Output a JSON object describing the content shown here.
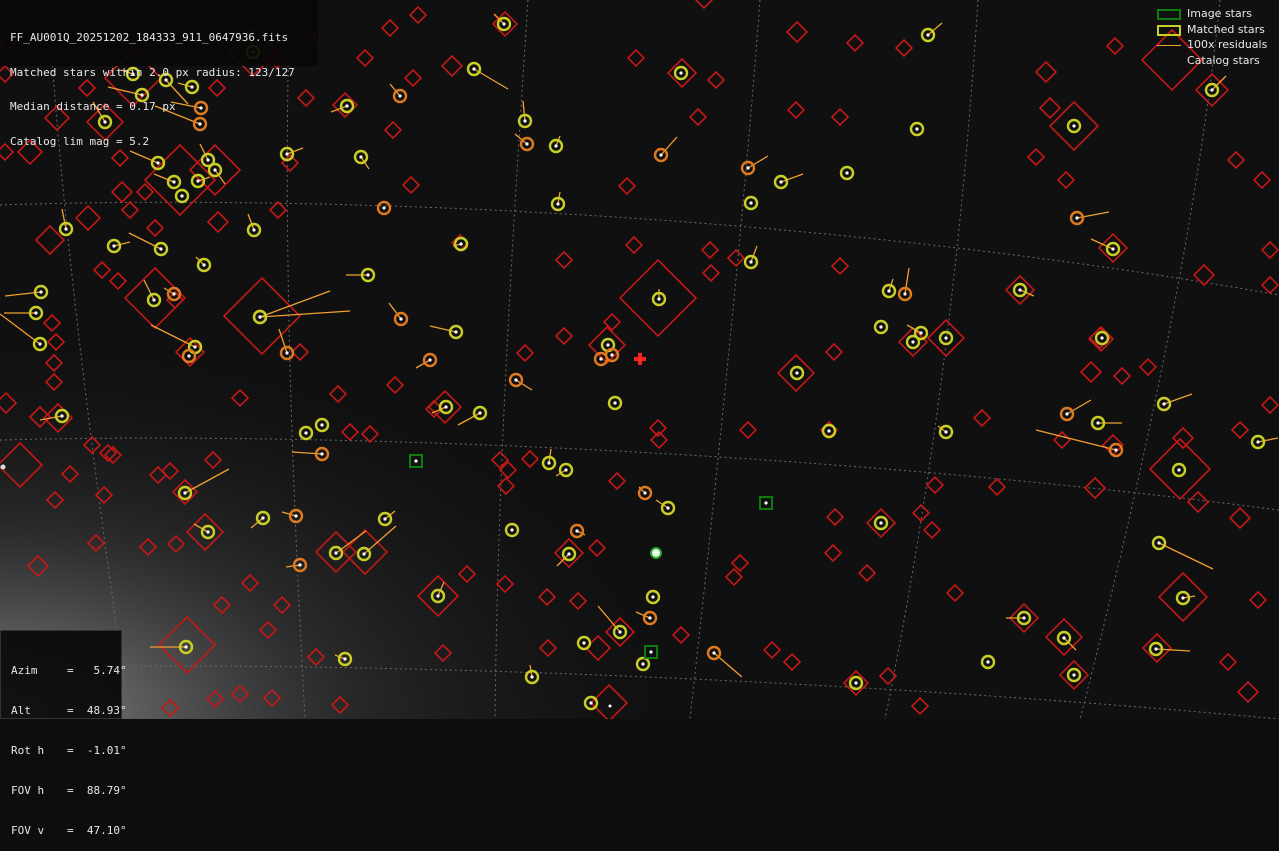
{
  "info": {
    "filename": "FF_AU001Q_20251202_184333_911_0647936.fits",
    "matched": "Matched stars within 2.0 px radius: 123/127",
    "median": "Median distance = 0.17 px",
    "limmag": "Catalog lim mag = 5.2"
  },
  "legend": {
    "image_stars": "Image stars",
    "matched_stars": "Matched stars",
    "residuals": "100x residuals",
    "catalog_stars": "Catalog stars"
  },
  "pointing": {
    "azim_label": "Azim",
    "azim_value": "=   5.74°",
    "alt_label": "Alt",
    "alt_value": "=  48.93°",
    "roth_label": "Rot h",
    "roth_value": "=  -1.01°",
    "fovh_label": "FOV h",
    "fovh_value": "=  88.79°",
    "fovv_label": "FOV v",
    "fovv_value": "=  47.10°"
  },
  "colors": {
    "catalog": "#c41818",
    "matched": "#c9cf25",
    "matched_orange": "#e07a1f",
    "image": "#0a7d0a",
    "residual": "#f0a030",
    "center_cross": "#ff2020",
    "grid": "#6a6a6a"
  }
}
